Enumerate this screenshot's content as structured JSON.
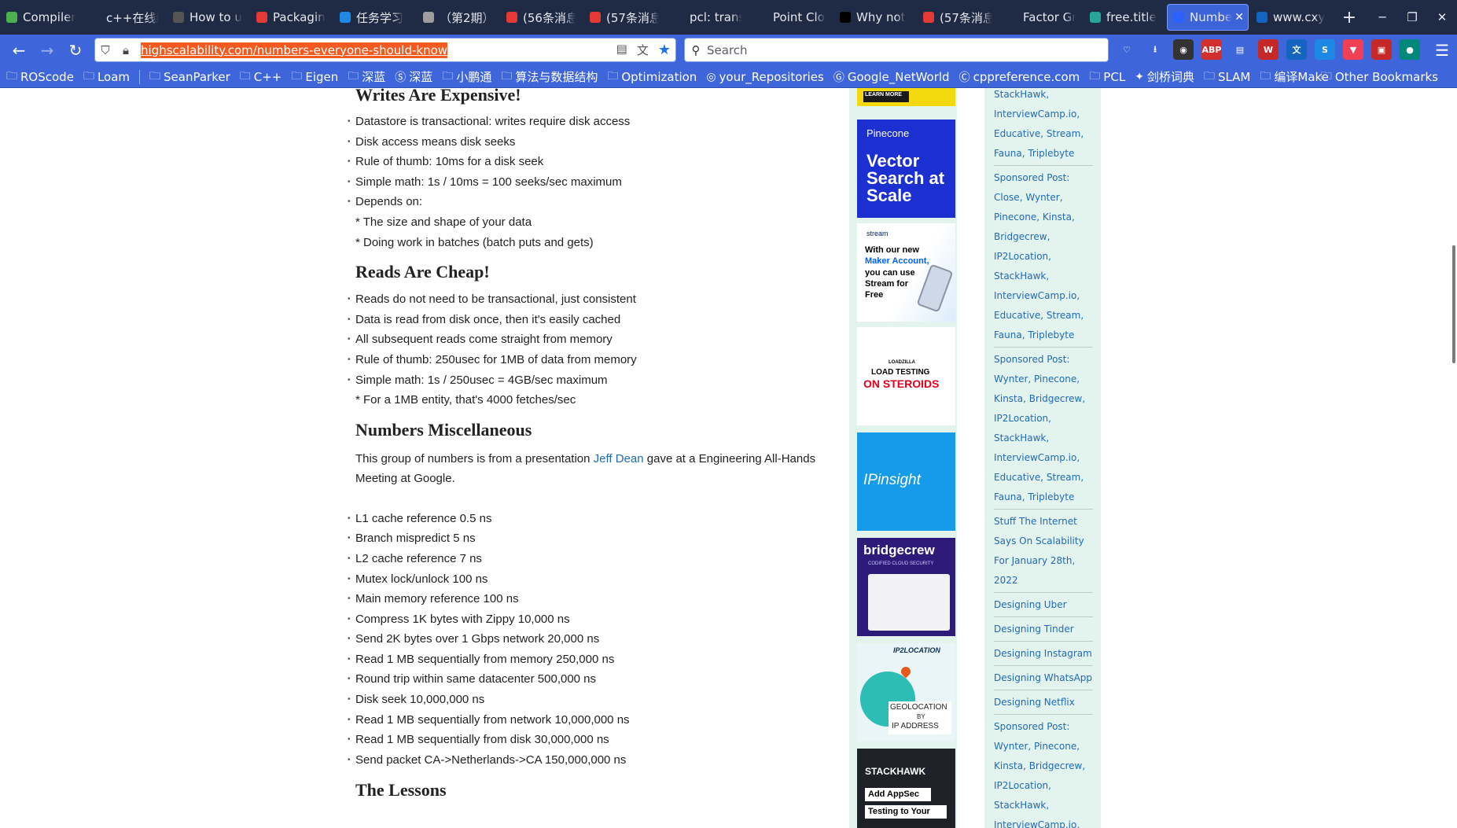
{
  "tabs": [
    {
      "label": "Compiler",
      "icon": "gear-icon",
      "color": "#4caf50"
    },
    {
      "label": "c++在线编译",
      "icon": "code-icon",
      "color": "#1f2a44"
    },
    {
      "label": "How to u",
      "icon": "book-icon",
      "color": "#555555"
    },
    {
      "label": "Packaging",
      "icon": "triangle-icon",
      "color": "#e53935"
    },
    {
      "label": "任务学习",
      "icon": "s-icon",
      "color": "#1e88e5"
    },
    {
      "label": "（第2期）",
      "icon": "person-icon",
      "color": "#9e9e9e"
    },
    {
      "label": "(56条消息",
      "icon": "c-icon",
      "color": "#e53935"
    },
    {
      "label": "(57条消息",
      "icon": "c-icon",
      "color": "#e53935"
    },
    {
      "label": "pcl: transfor",
      "icon": "blank-icon",
      "color": "#1f2a44"
    },
    {
      "label": "Point Cloud",
      "icon": "blank-icon",
      "color": "#1f2a44"
    },
    {
      "label": "Why not",
      "icon": "github-icon",
      "color": "#000000"
    },
    {
      "label": "(57条消息",
      "icon": "c-icon",
      "color": "#e53935"
    },
    {
      "label": "Factor Graph",
      "icon": "blank-icon",
      "color": "#1f2a44"
    },
    {
      "label": "free.title",
      "icon": "info-icon",
      "color": "#26a69a"
    },
    {
      "label": "Numbe",
      "icon": "hs-icon",
      "color": "#2962ff"
    },
    {
      "label": "www.cxy",
      "icon": "globe-icon",
      "color": "#1565c0"
    }
  ],
  "window_controls": {
    "minimize": "─",
    "restore": "❐",
    "close": "✕"
  },
  "nav": {
    "back": "←",
    "forward": "→",
    "reload": "↻",
    "url": "highscalability.com/numbers-everyone-should-know",
    "search_placeholder": "Search"
  },
  "extensions": [
    {
      "name": "pocket-icon",
      "label": "♡",
      "color": "#3e65d9"
    },
    {
      "name": "download-icon",
      "label": "⭳",
      "color": "#3e65d9"
    },
    {
      "name": "avatar-ext-icon",
      "label": "◉",
      "color": "#333333"
    },
    {
      "name": "abp-icon",
      "label": "ABP",
      "color": "#d32f2f"
    },
    {
      "name": "reader-icon",
      "label": "▤",
      "color": "#3e65d9"
    },
    {
      "name": "w-ext-icon",
      "label": "W",
      "color": "#c62828"
    },
    {
      "name": "translate-icon",
      "label": "文",
      "color": "#1565c0"
    },
    {
      "name": "s-ext-icon",
      "label": "S",
      "color": "#1e88e5"
    },
    {
      "name": "pocket-save-icon",
      "label": "▼",
      "color": "#ef4056"
    },
    {
      "name": "badge-ext-icon",
      "label": "▣",
      "color": "#c62828"
    },
    {
      "name": "circle-ext-icon",
      "label": "●",
      "color": "#00897b"
    }
  ],
  "bookmarks": [
    {
      "label": "ROScode",
      "icon": "folder-icon"
    },
    {
      "label": "Loam",
      "icon": "folder-icon"
    },
    {
      "label": "SeanParker",
      "icon": "folder-icon"
    },
    {
      "label": "C++",
      "icon": "folder-icon"
    },
    {
      "label": "Eigen",
      "icon": "folder-icon"
    },
    {
      "label": "深蓝",
      "icon": "folder-icon"
    },
    {
      "label": "深蓝",
      "icon": "s-icon"
    },
    {
      "label": "小鹏通",
      "icon": "folder-icon"
    },
    {
      "label": "算法与数据结构",
      "icon": "folder-icon"
    },
    {
      "label": "Optimization",
      "icon": "folder-icon"
    },
    {
      "label": "your_Repositories",
      "icon": "github-icon"
    },
    {
      "label": "Google_NetWorld",
      "icon": "google-icon"
    },
    {
      "label": "cppreference.com",
      "icon": "cpp-icon"
    },
    {
      "label": "PCL",
      "icon": "folder-icon"
    },
    {
      "label": "剑桥词典",
      "icon": "dict-icon"
    },
    {
      "label": "SLAM",
      "icon": "folder-icon"
    },
    {
      "label": "编译Make",
      "icon": "folder-icon"
    }
  ],
  "other_bookmarks": "Other Bookmarks",
  "article": {
    "writes_heading": "Writes Are Expensive!",
    "writes_items": [
      {
        "text": "Datastore is transactional: writes require disk access",
        "bullet": true
      },
      {
        "text": "Disk access means disk seeks",
        "bullet": true
      },
      {
        "text": "Rule of thumb: 10ms for a disk seek",
        "bullet": true
      },
      {
        "text": "Simple math: 1s / 10ms = 100 seeks/sec maximum",
        "bullet": true
      },
      {
        "text": "Depends on:",
        "bullet": true
      },
      {
        "text": "* The size and shape of your data",
        "bullet": false
      },
      {
        "text": "* Doing work in batches (batch puts and gets)",
        "bullet": false
      }
    ],
    "reads_heading": "Reads Are Cheap!",
    "reads_items": [
      {
        "text": "Reads do not need to be transactional, just consistent",
        "bullet": true
      },
      {
        "text": "Data is read from disk once, then it's easily cached",
        "bullet": true
      },
      {
        "text": "All subsequent reads come straight from memory",
        "bullet": true
      },
      {
        "text": "Rule of thumb: 250usec for 1MB of data from memory",
        "bullet": true
      },
      {
        "text": "Simple math: 1s / 250usec = 4GB/sec maximum",
        "bullet": true
      },
      {
        "text": "* For a 1MB entity, that's 4000 fetches/sec",
        "bullet": false
      }
    ],
    "misc_heading": "Numbers Miscellaneous",
    "misc_intro_before": "This group of numbers is from a presentation ",
    "misc_intro_link": "Jeff Dean",
    "misc_intro_after": " gave at a Engineering All-Hands Meeting at Google.",
    "misc_items": [
      "L1 cache reference 0.5 ns",
      "Branch mispredict 5 ns",
      "L2 cache reference 7 ns",
      "Mutex lock/unlock 100 ns",
      "Main memory reference 100 ns",
      "Compress 1K bytes with Zippy 10,000 ns",
      "Send 2K bytes over 1 Gbps network 20,000 ns",
      "Read 1 MB sequentially from memory 250,000 ns",
      "Round trip within same datacenter 500,000 ns",
      "Disk seek 10,000,000 ns",
      "Read 1 MB sequentially from network 10,000,000 ns",
      "Read 1 MB sequentially from disk 30,000,000 ns",
      "Send packet CA->Netherlands->CA 150,000,000 ns"
    ],
    "lessons_heading": "The Lessons"
  },
  "ads": {
    "top_partial": "LEARN MORE",
    "pinecone_brand": "Pinecone",
    "pinecone_text": "Vector Search at Scale",
    "stream_brand": "stream",
    "stream_text_1": "With our new",
    "stream_text_2": "Maker Account,",
    "stream_text_3": "you can use Stream for Free",
    "loadzilla_brand": "LOADZILLA",
    "loadzilla_text_1": "LOAD TESTING",
    "loadzilla_text_2": "ON STEROIDS",
    "ipinsight_text": "IPinsight",
    "bridgecrew_brand": "bridgecrew",
    "bridgecrew_sub": "CODIFIED CLOUD SECURITY",
    "ip2location_brand": "IP2LOCATION",
    "ip2location_text_1": "GEOLOCATION",
    "ip2location_text_2": "BY",
    "ip2location_text_3": "IP ADDRESS",
    "stackhawk_brand": "STACKHAWK",
    "stackhawk_text_1": "Add AppSec",
    "stackhawk_text_2": "Testing to Your"
  },
  "sidebar_links": [
    "StackHawk, InterviewCamp.io, Educative, Stream, Fauna, Triplebyte",
    "Sponsored Post: Close, Wynter, Pinecone, Kinsta, Bridgecrew, IP2Location, StackHawk, InterviewCamp.io, Educative, Stream, Fauna, Triplebyte",
    "Sponsored Post: Wynter, Pinecone, Kinsta, Bridgecrew, IP2Location, StackHawk, InterviewCamp.io, Educative, Stream, Fauna, Triplebyte",
    "Stuff The Internet Says On Scalability For January 28th, 2022",
    "Designing Uber",
    "Designing Tinder",
    "Designing Instagram",
    "Designing WhatsApp",
    "Designing Netflix",
    "Sponsored Post: Wynter, Pinecone, Kinsta, Bridgecrew, IP2Location, StackHawk, InterviewCamp.io, Educative, Stream,"
  ]
}
